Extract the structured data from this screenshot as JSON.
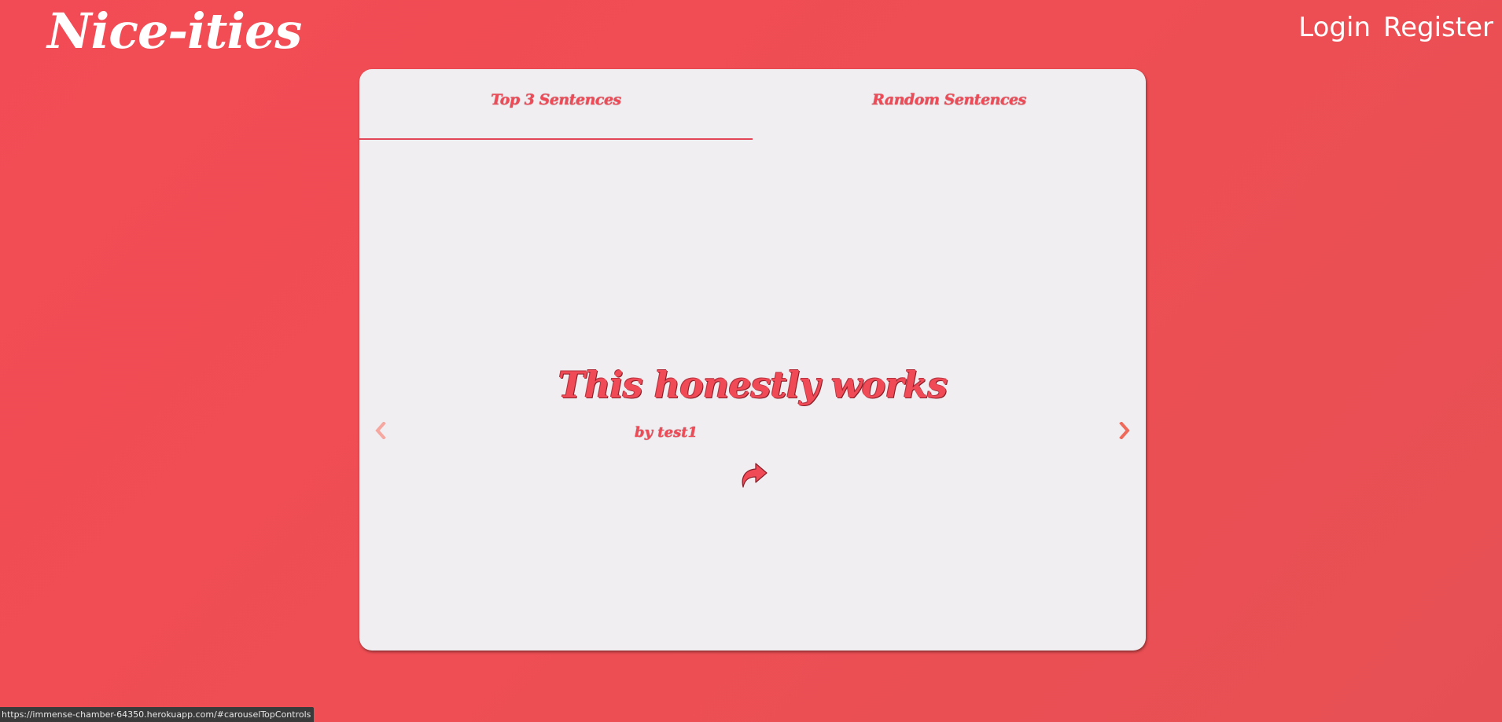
{
  "header": {
    "brand": "Nice-ities",
    "nav": {
      "login": "Login",
      "register": "Register"
    }
  },
  "tabs": [
    {
      "label": "Top 3 Sentences",
      "active": true
    },
    {
      "label": "Random Sentences",
      "active": false
    }
  ],
  "carousel": {
    "slide": {
      "sentence": "This honestly works",
      "author": "by test1"
    },
    "icons": {
      "prev": "chevron-left-icon",
      "next": "chevron-right-icon",
      "share": "share-arrow-icon"
    }
  },
  "status_bar": {
    "url": "https://immense-chamber-64350.herokuapp.com/#carouselTopControls"
  },
  "colors": {
    "background": "#f04d55",
    "card": "#f0eef1",
    "accent": "#f04a56",
    "prev_chevron": "#f5a7a0",
    "next_chevron": "#f06a5c"
  }
}
